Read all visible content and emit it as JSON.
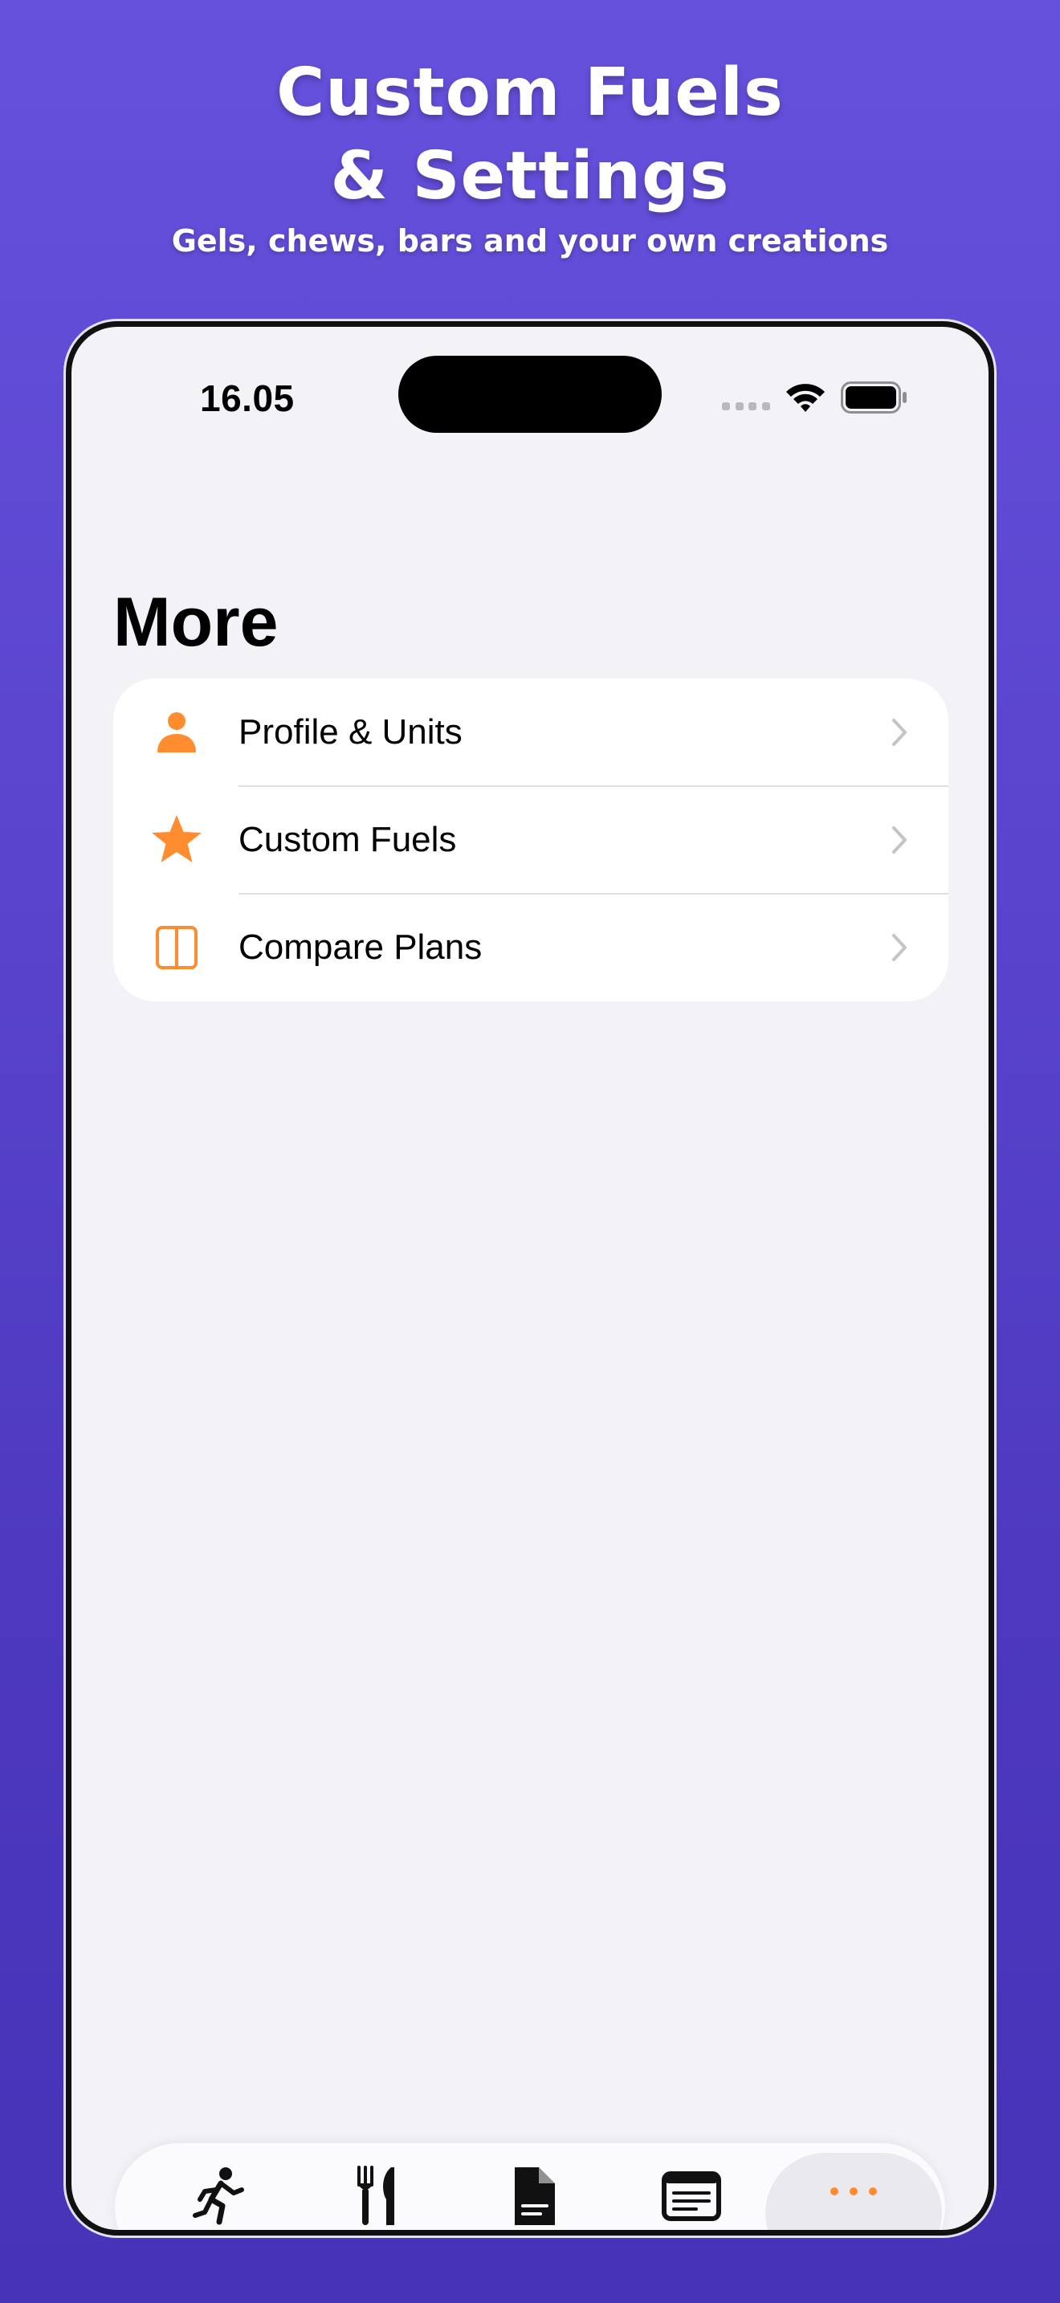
{
  "promo": {
    "title_line1": "Custom Fuels",
    "title_line2": "& Settings",
    "subtitle": "Gels, chews, bars and your own creations"
  },
  "status_bar": {
    "time": "16.05"
  },
  "page": {
    "title": "More"
  },
  "menu": {
    "items": [
      {
        "label": "Profile & Units",
        "icon": "person-icon"
      },
      {
        "label": "Custom Fuels",
        "icon": "star-icon"
      },
      {
        "label": "Compare Plans",
        "icon": "split-columns-icon"
      }
    ]
  },
  "tab_bar": {
    "tabs": [
      {
        "icon": "runner-icon"
      },
      {
        "icon": "fork-knife-icon"
      },
      {
        "icon": "document-icon"
      },
      {
        "icon": "text-box-icon"
      },
      {
        "icon": "more-dots-icon",
        "selected": true
      }
    ]
  },
  "colors": {
    "accent": "#ff8c2e",
    "background_top": "#6551dc",
    "background_bottom": "#4633b7",
    "screen_bg": "#f2f2f7",
    "chevron": "#c4c4c8"
  }
}
